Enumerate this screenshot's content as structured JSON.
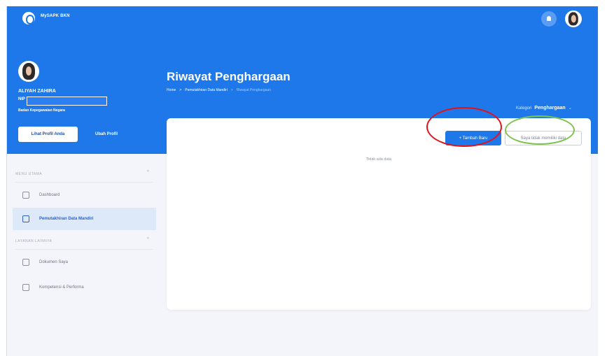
{
  "app": {
    "title": "MySAPK BKN"
  },
  "header": {
    "notification_icon": "bell-icon",
    "avatar_icon": "user-avatar-icon"
  },
  "profile": {
    "name": "ALIYAH ZAHIRA",
    "nip_label": "NIP",
    "agency": "Badan Kepegawaian Negara",
    "view_button": "Lihat Profil Anda",
    "edit_button": "Ubah Profil"
  },
  "page": {
    "title": "Riwayat Penghargaan",
    "breadcrumb": [
      {
        "label": "Home"
      },
      {
        "label": ">"
      },
      {
        "label": "Pemutakhiran Data Mandiri"
      },
      {
        "label": ">"
      },
      {
        "label": "Riwayat Penghargaan"
      }
    ],
    "category_label": "Kategori",
    "category_value": "Penghargaan",
    "category_chevron": "⌄"
  },
  "sidebar": {
    "sections": [
      {
        "heading": "MENU UTAMA",
        "toggle": "^",
        "items": [
          {
            "label": "Dashboard",
            "icon": "dashboard-icon"
          },
          {
            "label": "Pemutakhiran Data Mandiri",
            "icon": "document-edit-icon",
            "active": true
          }
        ]
      },
      {
        "heading": "LAYANAN LAINNYA",
        "toggle": "^",
        "items": [
          {
            "label": "Dokumen Saya",
            "icon": "folder-icon"
          },
          {
            "label": "Kompetensi & Performa",
            "icon": "grid-icon"
          }
        ]
      }
    ]
  },
  "content": {
    "add_button": "+ Tambah Baru",
    "no_data_button": "Saya tidak memiliki data",
    "empty_text": "Tidak ada data"
  },
  "annotations": {
    "highlight_red": "#e0131b",
    "highlight_green": "#7cc34a"
  },
  "colors": {
    "primary": "#1f78ea",
    "active_bg": "#dde8f8",
    "background": "#f4f5fa"
  }
}
